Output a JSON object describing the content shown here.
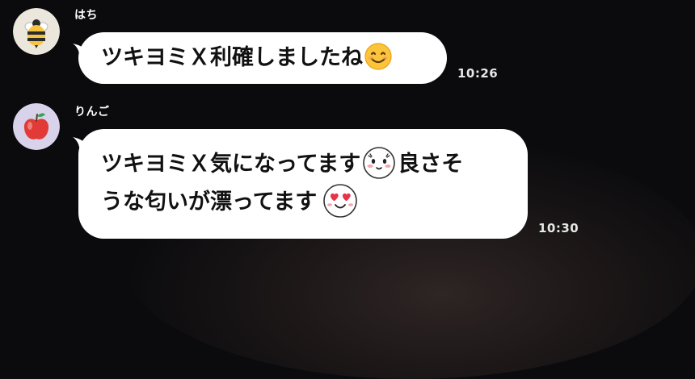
{
  "messages": [
    {
      "sender": "はち",
      "avatar_icon": "bee-icon",
      "text_before_emoji": "ツキヨミＸ利確しました",
      "text_after_emoji": "ね",
      "emoji": "smiling-face-emoji",
      "time": "10:26"
    },
    {
      "sender": "りんご",
      "avatar_icon": "apple-icon",
      "line1_text": "ツキヨミＸ気になってます",
      "line1_emoji": "blushing-face-emoji",
      "line1_text_after": "良さそ",
      "line2_text": "うな匂いが漂ってます",
      "line2_emoji": "heart-eyes-emoji",
      "time": "10:30"
    }
  ],
  "colors": {
    "background": "#0b0b0d",
    "bubble": "#ffffff",
    "text": "#111111",
    "time": "#e8e8e8"
  }
}
